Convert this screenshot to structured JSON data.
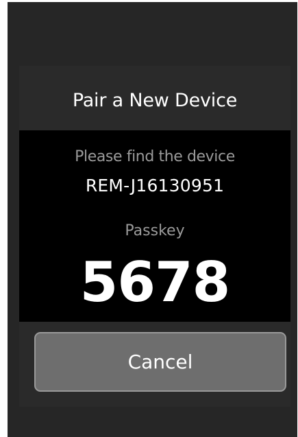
{
  "dialog": {
    "title": "Pair a New Device",
    "instruction": "Please find the device",
    "device_name": "REM-J16130951",
    "passkey_label": "Passkey",
    "passkey": "5678",
    "cancel_label": "Cancel"
  },
  "colors": {
    "screen_background": "#262626",
    "dialog_background": "#2a2a2a",
    "panel_background": "#000000",
    "button_background": "#6e6e6e",
    "button_border": "#9a9a9a",
    "primary_text": "#ffffff",
    "secondary_text": "#9a9a9a"
  }
}
